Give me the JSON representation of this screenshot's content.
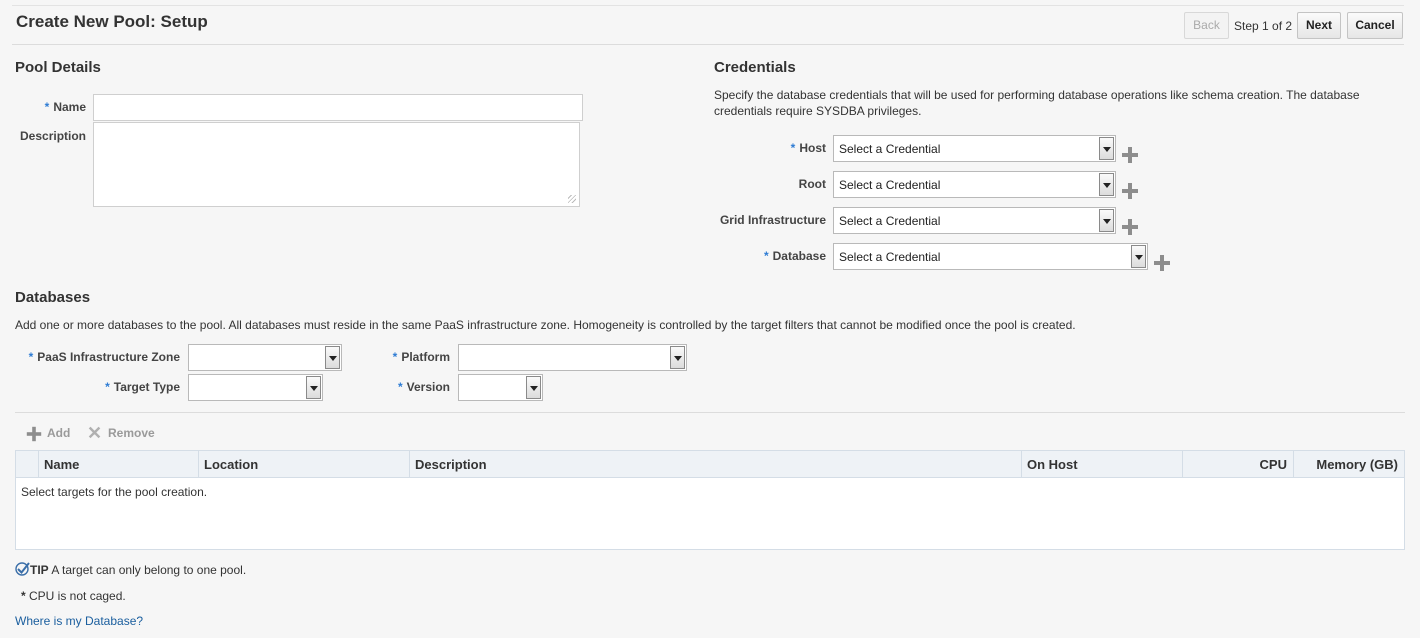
{
  "page": {
    "title": "Create New Pool: Setup"
  },
  "train": {
    "back": "Back",
    "step": "Step 1 of 2",
    "next": "Next",
    "cancel": "Cancel"
  },
  "pool_details": {
    "heading": "Pool Details",
    "name_label": "Name",
    "name_value": "",
    "description_label": "Description",
    "description_value": ""
  },
  "credentials": {
    "heading": "Credentials",
    "description": "Specify the database credentials that will be used for performing database operations like schema creation. The database credentials require SYSDBA privileges.",
    "rows": [
      {
        "label": "Host",
        "required": true,
        "value": "Select a Credential"
      },
      {
        "label": "Root",
        "required": false,
        "value": "Select a Credential"
      },
      {
        "label": "Grid Infrastructure",
        "required": false,
        "value": "Select a Credential"
      },
      {
        "label": "Database",
        "required": true,
        "value": "Select a Credential"
      }
    ]
  },
  "databases": {
    "heading": "Databases",
    "description": "Add one or more databases to the pool. All databases must reside in the same PaaS infrastructure zone. Homogeneity is controlled by the target filters that cannot be modified once the pool is created.",
    "filters": {
      "zone_label": "PaaS Infrastructure Zone",
      "target_type_label": "Target Type",
      "platform_label": "Platform",
      "version_label": "Version",
      "zone_value": "",
      "target_type_value": "",
      "platform_value": "",
      "version_value": ""
    },
    "toolbar": {
      "add": "Add",
      "remove": "Remove"
    },
    "columns": [
      "Name",
      "Location",
      "Description",
      "On Host",
      "CPU",
      "Memory (GB)"
    ],
    "empty_text": "Select targets for the pool creation."
  },
  "footer": {
    "tip_label": "TIP",
    "tip_text": "A target can only belong to one pool.",
    "cpu_note": "CPU is not caged.",
    "help_link": "Where is my Database?"
  },
  "colors": {
    "required": "#2e7cd4",
    "link": "#1a5e9e",
    "plus": "#8d8d8d"
  }
}
